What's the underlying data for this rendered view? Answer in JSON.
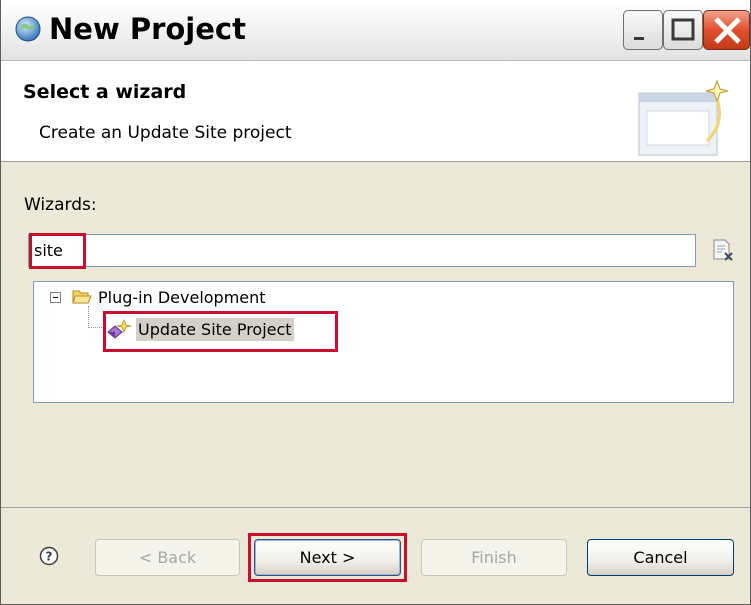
{
  "window": {
    "title": "New Project"
  },
  "banner": {
    "title": "Select a wizard",
    "description": "Create an Update Site project"
  },
  "wizards": {
    "label": "Wizards:",
    "filter_value": "site"
  },
  "tree": {
    "category": {
      "label": "Plug-in Development",
      "expanded": true
    },
    "items": [
      {
        "label": "Update Site Project",
        "selected": true
      }
    ]
  },
  "buttons": {
    "back": "< Back",
    "next": "Next >",
    "finish": "Finish",
    "cancel": "Cancel"
  },
  "colors": {
    "highlight": "#c8102e",
    "close_button": "#e0502f",
    "selection": "#d4d0c8"
  }
}
